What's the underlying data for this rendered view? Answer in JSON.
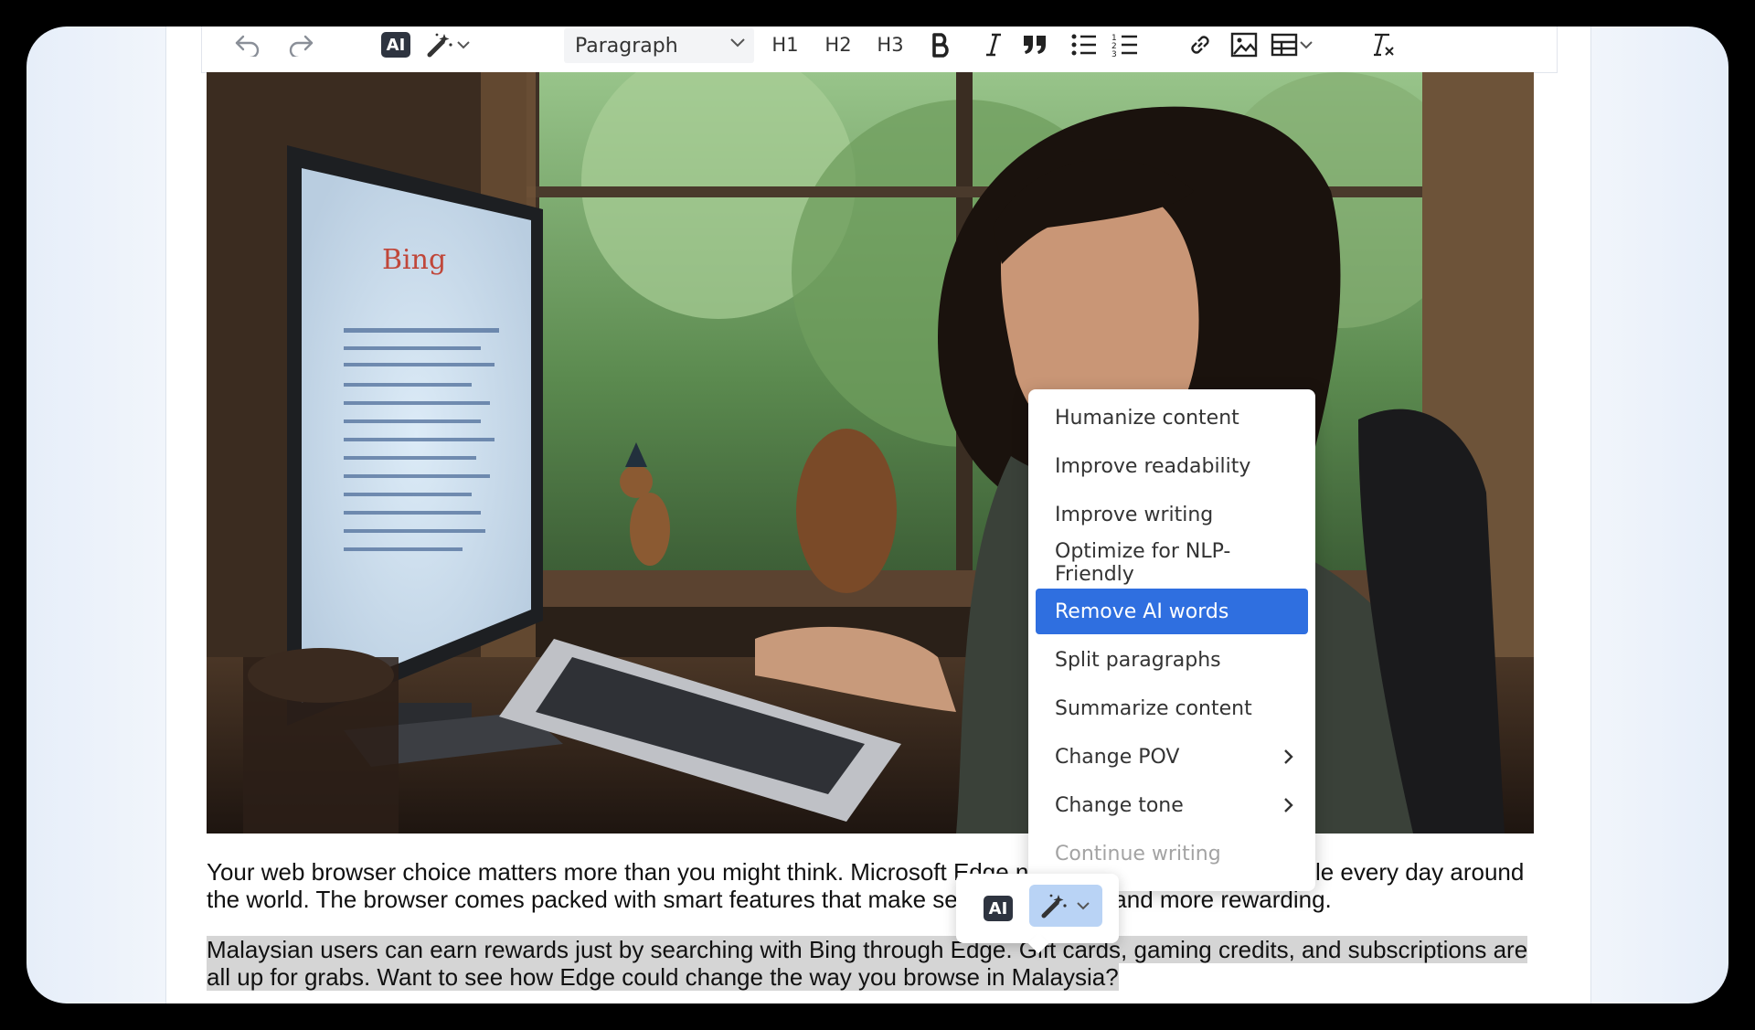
{
  "toolbar": {
    "undo_icon": "undo-icon",
    "redo_icon": "redo-icon",
    "ai_label": "AI",
    "wand_icon": "magic-wand-icon",
    "paragraph_select": "Paragraph",
    "h1": "H1",
    "h2": "H2",
    "h3": "H3",
    "bold_icon": "bold-icon",
    "italic_icon": "italic-icon",
    "quote_icon": "quote-icon",
    "bullet_list_icon": "bullet-list-icon",
    "numbered_list_icon": "numbered-list-icon",
    "link_icon": "link-icon",
    "image_icon": "image-icon",
    "table_icon": "table-icon",
    "clear_format_icon": "clear-formatting-icon"
  },
  "content": {
    "image_alt": "Woman using Bing in a browser on a desktop monitor",
    "paragraph1": "Your web browser choice matters more than you might think. Microsoft Edge now serves 100 million people every day around the world. The browser comes packed with smart features that make searching easier and more rewarding.",
    "paragraph2": "Malaysian users can earn rewards just by searching with Bing through Edge. Gift cards, gaming credits, and subscriptions are all up for grabs. Want to see how Edge could change the way you browse in Malaysia?"
  },
  "ai_menu": {
    "items": [
      {
        "label": "Humanize content"
      },
      {
        "label": "Improve readability"
      },
      {
        "label": "Improve writing"
      },
      {
        "label": "Optimize for NLP-Friendly"
      },
      {
        "label": "Remove AI words",
        "state": "highlighted"
      },
      {
        "label": "Split paragraphs"
      },
      {
        "label": "Summarize content"
      },
      {
        "label": "Change POV",
        "submenu": true
      },
      {
        "label": "Change tone",
        "submenu": true
      },
      {
        "label": "Continue writing",
        "state": "disabled"
      }
    ]
  },
  "floating_toolbar": {
    "ai_label": "AI",
    "wand_icon": "magic-wand-icon"
  },
  "colors": {
    "accent": "#2f6fe0",
    "selection": "#d5d5d5",
    "wand_active": "#b9d3f5"
  }
}
